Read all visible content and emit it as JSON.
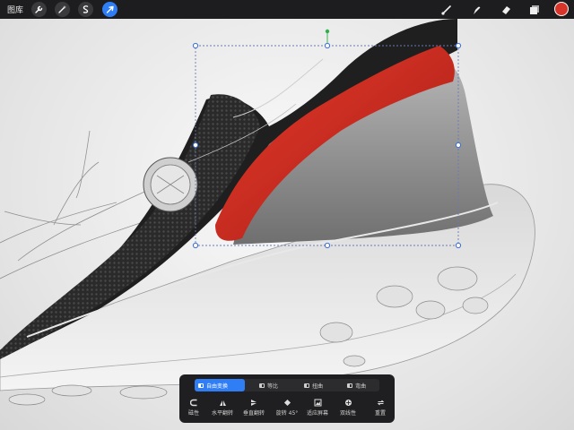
{
  "topbar": {
    "gallery_label": "图库",
    "tools": [
      "wrench-icon",
      "magic-wand-icon",
      "selection-s-icon",
      "transform-arrow-icon"
    ],
    "active_tool": "transform-arrow-icon",
    "right_tools": [
      "brush-icon",
      "smudge-icon",
      "eraser-icon",
      "layers-icon"
    ],
    "current_color": "#d8342a"
  },
  "transform": {
    "modes": [
      {
        "label": "自由变换",
        "selected": true
      },
      {
        "label": "等比",
        "selected": false
      },
      {
        "label": "扭曲",
        "selected": false
      },
      {
        "label": "弯曲",
        "selected": false
      }
    ],
    "actions": [
      {
        "label": "磁性",
        "icon": "magnet-icon"
      },
      {
        "label": "水平翻转",
        "icon": "flip-horizontal-icon"
      },
      {
        "label": "垂直翻转",
        "icon": "flip-vertical-icon"
      },
      {
        "label": "旋转 45°",
        "icon": "rotate-45-icon"
      },
      {
        "label": "适应屏幕",
        "icon": "fit-screen-icon"
      },
      {
        "label": "双线性",
        "icon": "bilinear-icon"
      },
      {
        "label": "重置",
        "icon": "reset-icon"
      }
    ]
  },
  "colors": {
    "accent": "#2f7ef5",
    "toolbar_bg": "#1d1d1f",
    "shoe_red": "#cf2a1f"
  }
}
